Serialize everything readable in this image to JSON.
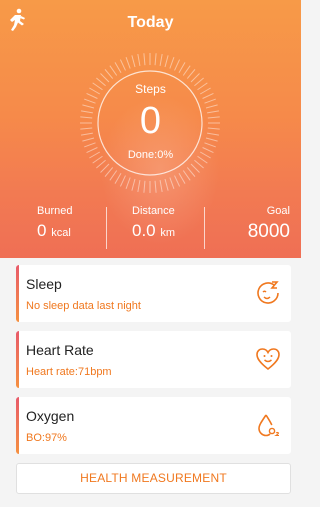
{
  "header": {
    "title": "Today",
    "run_icon": "running-figure-icon"
  },
  "steps": {
    "label": "Steps",
    "value": "0",
    "done": "Done:0%",
    "progress": 0
  },
  "stats": {
    "burned": {
      "label": "Burned",
      "value": "0",
      "unit": "kcal"
    },
    "distance": {
      "label": "Distance",
      "value": "0.0",
      "unit": "km"
    },
    "goal": {
      "label": "Goal",
      "value": "8000"
    }
  },
  "cards": [
    {
      "title": "Sleep",
      "subtitle": "No sleep data last night",
      "icon": "sleep-face-icon"
    },
    {
      "title": "Heart Rate",
      "subtitle": "Heart rate:71bpm",
      "icon": "heart-face-icon"
    },
    {
      "title": "Oxygen",
      "subtitle": "BO:97%",
      "icon": "oxygen-drop-icon"
    }
  ],
  "measure_button": "HEALTH MEASUREMENT",
  "colors": {
    "accent": "#f0781f",
    "hero_top": "#f79a48",
    "hero_bottom": "#ef6f55"
  }
}
